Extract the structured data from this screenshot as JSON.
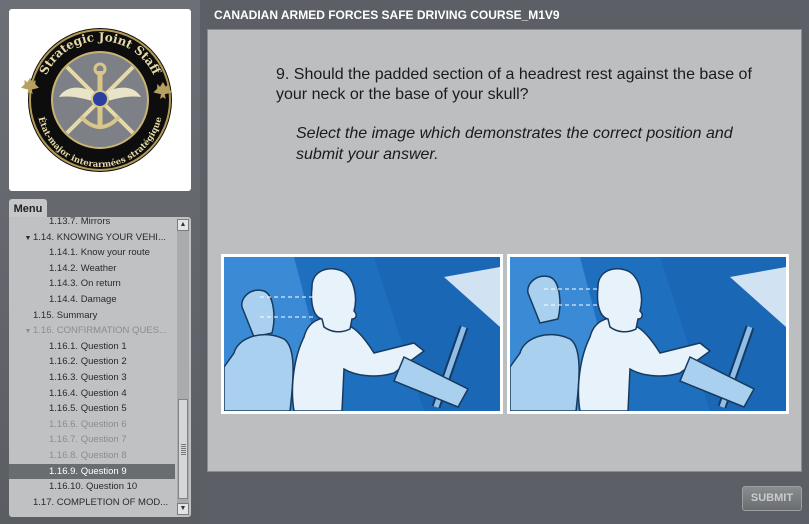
{
  "header": {
    "title": "CANADIAN ARMED FORCES SAFE DRIVING COURSE_M1V9"
  },
  "logo": {
    "text_top": "Strategic Joint Staff",
    "text_bottom": "État-major interarmées stratégique"
  },
  "menu": {
    "tab_label": "Menu",
    "items": [
      {
        "label": "1.13.7. Mirrors",
        "level": 2,
        "state": "normal",
        "arrow": ""
      },
      {
        "label": "1.14. KNOWING YOUR VEHI...",
        "level": 1,
        "state": "normal",
        "arrow": "▼"
      },
      {
        "label": "1.14.1. Know your route",
        "level": 2,
        "state": "normal",
        "arrow": ""
      },
      {
        "label": "1.14.2. Weather",
        "level": 2,
        "state": "normal",
        "arrow": ""
      },
      {
        "label": "1.14.3. On return",
        "level": 2,
        "state": "normal",
        "arrow": ""
      },
      {
        "label": "1.14.4. Damage",
        "level": 2,
        "state": "normal",
        "arrow": ""
      },
      {
        "label": "1.15. Summary",
        "level": 1,
        "state": "normal",
        "arrow": ""
      },
      {
        "label": "1.16. CONFIRMATION QUES...",
        "level": 1,
        "state": "dim",
        "arrow": "▼"
      },
      {
        "label": "1.16.1. Question 1",
        "level": 2,
        "state": "normal",
        "arrow": ""
      },
      {
        "label": "1.16.2. Question 2",
        "level": 2,
        "state": "normal",
        "arrow": ""
      },
      {
        "label": "1.16.3. Question 3",
        "level": 2,
        "state": "normal",
        "arrow": ""
      },
      {
        "label": "1.16.4. Question 4",
        "level": 2,
        "state": "normal",
        "arrow": ""
      },
      {
        "label": "1.16.5. Question 5",
        "level": 2,
        "state": "normal",
        "arrow": ""
      },
      {
        "label": "1.16.6. Question 6",
        "level": 2,
        "state": "dim",
        "arrow": ""
      },
      {
        "label": "1.16.7. Question 7",
        "level": 2,
        "state": "dim",
        "arrow": ""
      },
      {
        "label": "1.16.8. Question 8",
        "level": 2,
        "state": "dim",
        "arrow": ""
      },
      {
        "label": "1.16.9. Question 9",
        "level": 2,
        "state": "selected",
        "arrow": ""
      },
      {
        "label": "1.16.10. Question 10",
        "level": 2,
        "state": "normal",
        "arrow": ""
      },
      {
        "label": "1.17. COMPLETION OF MOD...",
        "level": 1,
        "state": "normal",
        "arrow": ""
      }
    ]
  },
  "question": {
    "text": "9. Should the padded section of a headrest rest against the base of your neck or the base of your skull?",
    "instruction": "Select the image which demonstrates the correct position and submit your answer."
  },
  "options": [
    {
      "id": "option-left"
    },
    {
      "id": "option-right"
    }
  ],
  "submit": {
    "label": "SUBMIT"
  },
  "colors": {
    "header_bg": "#5c6066",
    "content_bg": "#bdbec0",
    "illustration_blue": "#1f6fbf",
    "selected_menu": "#6a6d70"
  }
}
